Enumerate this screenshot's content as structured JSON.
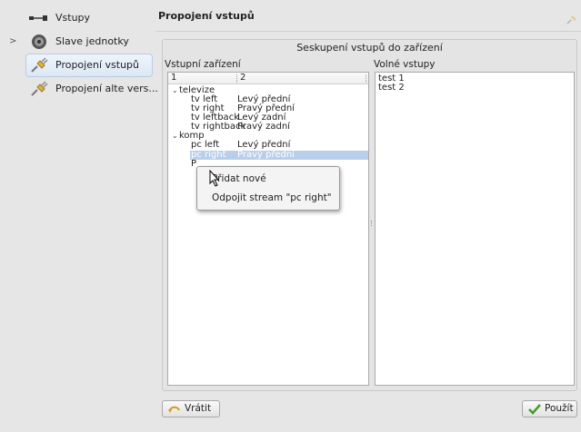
{
  "sidebar": {
    "items": [
      {
        "label": "Vstupy"
      },
      {
        "label": "Slave jednotky",
        "expander": ">"
      },
      {
        "label": "Propojení vstupů"
      },
      {
        "label": "Propojení alte vers..."
      }
    ]
  },
  "page": {
    "title": "Propojení vstupů",
    "group_title": "Seskupení vstupů do zařízení",
    "left_label": "Vstupní zařízení",
    "right_label": "Volné vstupy"
  },
  "tree": {
    "headers": [
      "1",
      "2"
    ],
    "rows": [
      {
        "col1": "televize",
        "col2": "",
        "expander": "⌄"
      },
      {
        "col1": "tv left",
        "col2": "Levý přední"
      },
      {
        "col1": "tv right",
        "col2": "Pravý přední"
      },
      {
        "col1": "tv leftback",
        "col2": "Levý zadní"
      },
      {
        "col1": "tv rightback",
        "col2": "Pravý zadní"
      },
      {
        "col1": "komp",
        "col2": "",
        "expander": "⌄"
      },
      {
        "col1": "pc left",
        "col2": "Levý přední"
      },
      {
        "col1": "pc right",
        "col2": "Pravý přední"
      },
      {
        "col1": "P",
        "col2": ""
      }
    ]
  },
  "free_inputs": [
    "test 1",
    "test 2"
  ],
  "context_menu": {
    "items": [
      "Přidat nové",
      "Odpojit stream \"pc right\""
    ]
  },
  "buttons": {
    "revert": "Vrátit",
    "apply": "Použít"
  },
  "colors": {
    "selection": "#b9cfe9",
    "background": "#e6e6e6",
    "accent_green": "#4a9a2a"
  }
}
